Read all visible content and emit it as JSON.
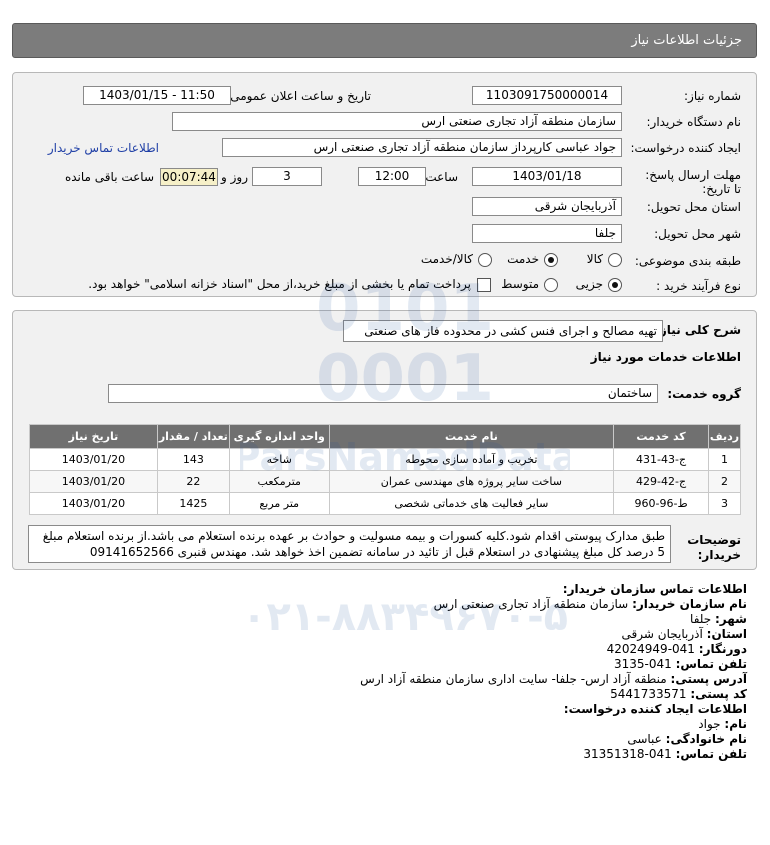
{
  "header": {
    "title": "جزئیات اطلاعات نیاز"
  },
  "details": {
    "need_number_label": "شماره نیاز:",
    "need_number": "1103091750000014",
    "announce_label": "تاریخ و ساعت اعلان عمومی:",
    "announce_value": "1403/01/15 - 11:50",
    "buyer_org_label": "نام دستگاه خریدار:",
    "buyer_org": "سازمان منطقه آزاد تجاری صنعتی ارس",
    "creator_label": "ایجاد کننده درخواست:",
    "creator": "جواد عباسی کارپرداز سازمان منطقه آزاد تجاری صنعتی ارس",
    "contact_link": "اطلاعات تماس خریدار",
    "deadline_label": "مهلت ارسال پاسخ: تا تاریخ:",
    "deadline_date": "1403/01/18",
    "time_label": "ساعت",
    "deadline_time": "12:00",
    "days_value": "3",
    "days_label": "روز و",
    "remaining_time": "00:07:44",
    "remaining_label": "ساعت باقی مانده",
    "province_label": "استان محل تحویل:",
    "province": "آذربایجان شرقی",
    "city_label": "شهر محل تحویل:",
    "city": "جلفا",
    "category_label": "طبقه بندی موضوعی:",
    "category_options": [
      "کالا",
      "خدمت",
      "کالا/خدمت"
    ],
    "category_selected": "خدمت",
    "process_label": "نوع فرآیند خرید :",
    "process_options": [
      "جزیی",
      "متوسط"
    ],
    "process_selected": "جزیی",
    "payment_note": "پرداخت تمام یا بخشی از مبلغ خرید،از محل \"اسناد خزانه اسلامی\" خواهد بود."
  },
  "need": {
    "summary_label": "شرح کلی نیاز:",
    "summary": "تهیه مصالح و اجرای فنس کشی در محدوده فاز های صنعتی",
    "services_heading": "اطلاعات خدمات مورد نیاز",
    "group_label": "گروه خدمت:",
    "group_value": "ساختمان",
    "table": {
      "headers": [
        "ردیف",
        "کد خدمت",
        "نام خدمت",
        "واحد اندازه گیری",
        "تعداد / مقدار",
        "تاریخ نیاز"
      ],
      "rows": [
        [
          "1",
          "ج-43-431",
          "تخریب و آماده سازی محوطه",
          "شاخه",
          "143",
          "1403/01/20"
        ],
        [
          "2",
          "ج-42-429",
          "ساخت سایر پروژه های مهندسی عمران",
          "مترمکعب",
          "22",
          "1403/01/20"
        ],
        [
          "3",
          "ط-96-960",
          "سایر فعالیت های خدماتی شخصی",
          "متر مربع",
          "1425",
          "1403/01/20"
        ]
      ]
    },
    "notes_label": "توضیحات خریدار:",
    "notes": "طبق مدارک پیوستی اقدام شود.کلیه کسورات و بیمه مسولیت و حوادث بر عهده برنده استعلام می باشد.از برنده استعلام مبلغ 5 درصد کل مبلغ پیشنهادی در استعلام قبل از تائید در سامانه تضمین اخذ خواهد شد. مهندس قنبری 09141652566"
  },
  "contact": {
    "heading": "اطلاعات تماس سازمان خریدار:",
    "lines": [
      {
        "label": "نام سازمان خریدار:",
        "value": "سازمان منطقه آزاد تجاری صنعتی ارس"
      },
      {
        "label": "شهر:",
        "value": "جلفا"
      },
      {
        "label": "استان:",
        "value": "آذربایجان شرقی"
      },
      {
        "label": "دورنگار:",
        "value": "041-42024949"
      },
      {
        "label": "تلفن تماس:",
        "value": "041-3135"
      },
      {
        "label": "آدرس پستی:",
        "value": "منطقه آزاد ارس- جلفا- سایت اداری سازمان منطقه آزاد ارس"
      },
      {
        "label": "کد پستی:",
        "value": "5441733571"
      }
    ],
    "creator_heading": "اطلاعات ایجاد کننده درخواست:",
    "creator_lines": [
      {
        "label": "نام:",
        "value": "جواد"
      },
      {
        "label": "نام خانوادگی:",
        "value": "عباسی"
      },
      {
        "label": "تلفن تماس:",
        "value": "041-31351318"
      }
    ]
  },
  "watermark": {
    "brand": "ParsNamadData",
    "phone": "۰۲۱-۸۸۳۴۹۶۷۰-۵"
  }
}
